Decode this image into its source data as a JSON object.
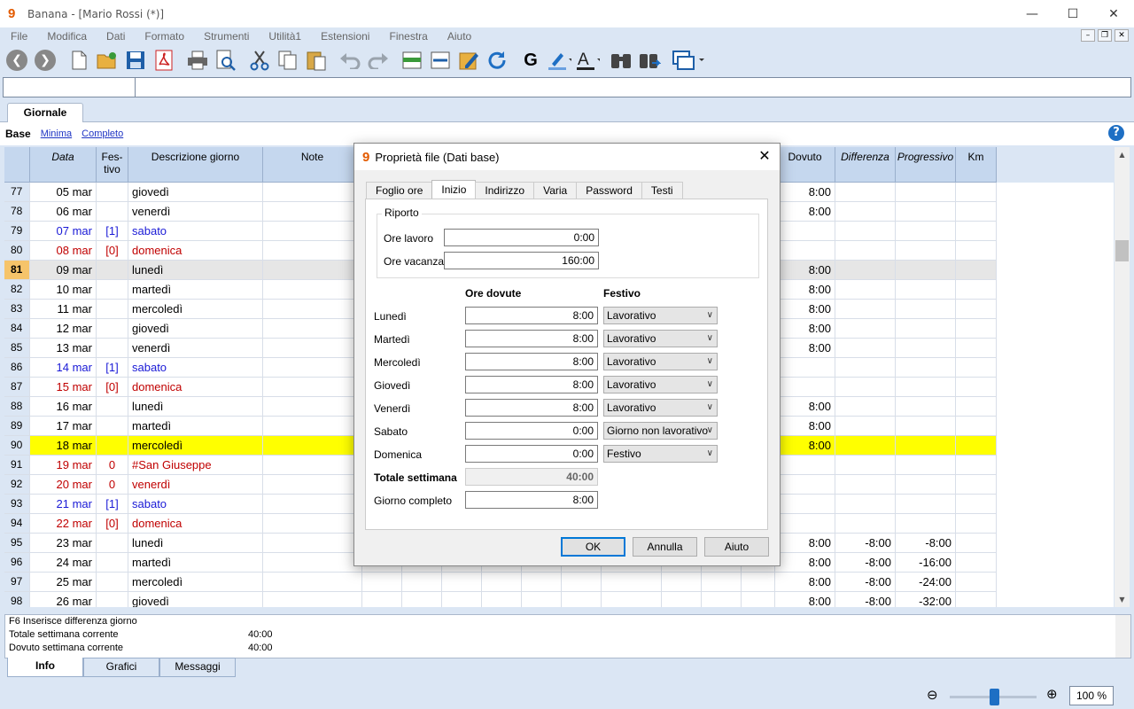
{
  "window": {
    "title": "Banana - [Mario Rossi (*)]",
    "logo": "9"
  },
  "menu": [
    "File",
    "Modifica",
    "Dati",
    "Formato",
    "Strumenti",
    "Utilità1",
    "Estensioni",
    "Finestra",
    "Aiuto"
  ],
  "doc_tab": "Giornale",
  "views": {
    "base": "Base",
    "minima": "Minima",
    "completo": "Completo"
  },
  "columns": {
    "data": "Data",
    "festivo": "Fes-\ntivo",
    "descrizione": "Descrizione giorno",
    "note": "Note",
    "dovuto": "Dovuto",
    "differenza": "Differenza",
    "progressivo": "Progressivo",
    "km": "Km"
  },
  "rows": [
    {
      "n": "77",
      "date": "05 mar",
      "fest": "",
      "desc": "giovedì",
      "dovuto": "8:00",
      "diff": "",
      "prog": "",
      "style": "normal"
    },
    {
      "n": "78",
      "date": "06 mar",
      "fest": "",
      "desc": "venerdì",
      "dovuto": "8:00",
      "diff": "",
      "prog": "",
      "style": "normal"
    },
    {
      "n": "79",
      "date": "07 mar",
      "fest": "[1]",
      "desc": "sabato",
      "dovuto": "",
      "diff": "",
      "prog": "",
      "style": "blue"
    },
    {
      "n": "80",
      "date": "08 mar",
      "fest": "[0]",
      "desc": "domenica",
      "dovuto": "",
      "diff": "",
      "prog": "",
      "style": "red"
    },
    {
      "n": "81",
      "date": "09 mar",
      "fest": "",
      "desc": "lunedì",
      "dovuto": "8:00",
      "diff": "",
      "prog": "",
      "style": "current"
    },
    {
      "n": "82",
      "date": "10 mar",
      "fest": "",
      "desc": "martedì",
      "dovuto": "8:00",
      "diff": "",
      "prog": "",
      "style": "normal"
    },
    {
      "n": "83",
      "date": "11 mar",
      "fest": "",
      "desc": "mercoledì",
      "dovuto": "8:00",
      "diff": "",
      "prog": "",
      "style": "normal"
    },
    {
      "n": "84",
      "date": "12 mar",
      "fest": "",
      "desc": "giovedì",
      "dovuto": "8:00",
      "diff": "",
      "prog": "",
      "style": "normal"
    },
    {
      "n": "85",
      "date": "13 mar",
      "fest": "",
      "desc": "venerdì",
      "dovuto": "8:00",
      "diff": "",
      "prog": "",
      "style": "normal"
    },
    {
      "n": "86",
      "date": "14 mar",
      "fest": "[1]",
      "desc": "sabato",
      "dovuto": "",
      "diff": "",
      "prog": "",
      "style": "blue"
    },
    {
      "n": "87",
      "date": "15 mar",
      "fest": "[0]",
      "desc": "domenica",
      "dovuto": "",
      "diff": "",
      "prog": "",
      "style": "red"
    },
    {
      "n": "88",
      "date": "16 mar",
      "fest": "",
      "desc": "lunedì",
      "dovuto": "8:00",
      "diff": "",
      "prog": "",
      "style": "normal"
    },
    {
      "n": "89",
      "date": "17 mar",
      "fest": "",
      "desc": "martedì",
      "dovuto": "8:00",
      "diff": "",
      "prog": "",
      "style": "normal"
    },
    {
      "n": "90",
      "date": "18 mar",
      "fest": "",
      "desc": "mercoledì",
      "dovuto": "8:00",
      "diff": "",
      "prog": "",
      "style": "yellow"
    },
    {
      "n": "91",
      "date": "19 mar",
      "fest": "0",
      "desc": "#San Giuseppe",
      "dovuto": "",
      "diff": "",
      "prog": "",
      "style": "red"
    },
    {
      "n": "92",
      "date": "20 mar",
      "fest": "0",
      "desc": "venerdì",
      "dovuto": "",
      "diff": "",
      "prog": "",
      "style": "red"
    },
    {
      "n": "93",
      "date": "21 mar",
      "fest": "[1]",
      "desc": "sabato",
      "dovuto": "",
      "diff": "",
      "prog": "",
      "style": "blue"
    },
    {
      "n": "94",
      "date": "22 mar",
      "fest": "[0]",
      "desc": "domenica",
      "dovuto": "",
      "diff": "",
      "prog": "",
      "style": "red"
    },
    {
      "n": "95",
      "date": "23 mar",
      "fest": "",
      "desc": "lunedì",
      "dovuto": "8:00",
      "diff": "-8:00",
      "prog": "-8:00",
      "style": "normal"
    },
    {
      "n": "96",
      "date": "24 mar",
      "fest": "",
      "desc": "martedì",
      "dovuto": "8:00",
      "diff": "-8:00",
      "prog": "-16:00",
      "style": "normal"
    },
    {
      "n": "97",
      "date": "25 mar",
      "fest": "",
      "desc": "mercoledì",
      "dovuto": "8:00",
      "diff": "-8:00",
      "prog": "-24:00",
      "style": "normal"
    },
    {
      "n": "98",
      "date": "26 mar",
      "fest": "",
      "desc": "giovedì",
      "dovuto": "8:00",
      "diff": "-8:00",
      "prog": "-32:00",
      "style": "normal"
    }
  ],
  "row_colors": {
    "blue": "#1a1ad6",
    "red": "#c00000",
    "current_bg": "#e6e6e6",
    "current_num": "#f6c46a",
    "yellow": "#ffff00"
  },
  "info": {
    "line1": "F6 Inserisce differenza giorno",
    "line2_label": "Totale settimana corrente",
    "line2_value": "40:00",
    "line3_label": "Dovuto settimana corrente",
    "line3_value": "40:00"
  },
  "bottom_tabs": [
    "Info",
    "Grafici",
    "Messaggi"
  ],
  "zoom": "100 %",
  "dialog": {
    "title": "Proprietà file (Dati base)",
    "tabs": [
      "Foglio ore",
      "Inizio",
      "Indirizzo",
      "Varia",
      "Password",
      "Testi"
    ],
    "active_tab": "Inizio",
    "riporto_label": "Riporto",
    "ore_lavoro_label": "Ore lavoro",
    "ore_lavoro": "0:00",
    "ore_vacanza_label": "Ore vacanza",
    "ore_vacanza": "160:00",
    "col_ore": "Ore dovute",
    "col_festivo": "Festivo",
    "days": [
      {
        "name": "Lunedì",
        "ore": "8:00",
        "festivo": "Lavorativo"
      },
      {
        "name": "Martedì",
        "ore": "8:00",
        "festivo": "Lavorativo"
      },
      {
        "name": "Mercoledì",
        "ore": "8:00",
        "festivo": "Lavorativo"
      },
      {
        "name": "Giovedì",
        "ore": "8:00",
        "festivo": "Lavorativo"
      },
      {
        "name": "Venerdì",
        "ore": "8:00",
        "festivo": "Lavorativo"
      },
      {
        "name": "Sabato",
        "ore": "0:00",
        "festivo": "Giorno non lavorativo"
      },
      {
        "name": "Domenica",
        "ore": "0:00",
        "festivo": "Festivo"
      }
    ],
    "totale_label": "Totale settimana",
    "totale": "40:00",
    "giorno_completo_label": "Giorno completo",
    "giorno_completo": "8:00",
    "ok": "OK",
    "annulla": "Annulla",
    "aiuto": "Aiuto"
  }
}
